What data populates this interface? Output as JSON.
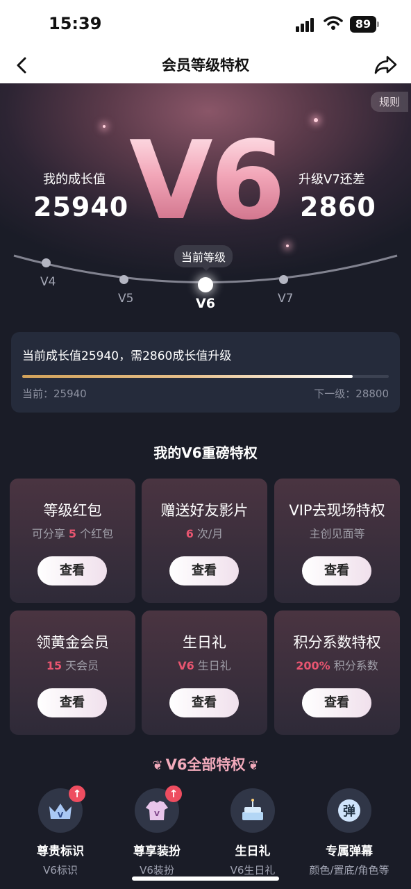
{
  "status_bar": {
    "time": "15:39",
    "battery": "89"
  },
  "nav": {
    "title": "会员等级特权",
    "back_icon": "chevron-left-icon",
    "share_icon": "share-arrow-icon"
  },
  "hero": {
    "rules": "规则",
    "level": "V6",
    "growth_label": "我的成长值",
    "growth_value": "25940",
    "upgrade_label": "升级V7还差",
    "upgrade_value": "2860",
    "current_tip": "当前等级",
    "levels": [
      "V4",
      "V5",
      "V6",
      "V7"
    ],
    "current_level_index": 2
  },
  "progress": {
    "text": "当前成长值25940，需2860成长值升级",
    "current_label": "当前：25940",
    "next_label": "下一级：28800",
    "fraction": 0.9007
  },
  "section_title": "我的V6重磅特权",
  "cards": [
    {
      "title": "等级红包",
      "sub_pre": "可分享 ",
      "sub_hl": "5",
      "sub_post": " 个红包",
      "button": "查看"
    },
    {
      "title": "赠送好友影片",
      "sub_pre": "",
      "sub_hl": "6",
      "sub_post": " 次/月",
      "button": "查看"
    },
    {
      "title": "VIP去现场特权",
      "sub_pre": "主创见面等",
      "sub_hl": "",
      "sub_post": "",
      "button": "查看"
    },
    {
      "title": "领黄金会员",
      "sub_pre": "",
      "sub_hl": "15",
      "sub_post": " 天会员",
      "button": "查看"
    },
    {
      "title": "生日礼",
      "sub_pre": "",
      "sub_hl": "V6",
      "sub_post": " 生日礼",
      "button": "查看"
    },
    {
      "title": "积分系数特权",
      "sub_pre": "",
      "sub_hl": "200%",
      "sub_post": " 积分系数",
      "button": "查看"
    }
  ],
  "all_privileges_title": "V6全部特权",
  "privileges": [
    {
      "icon": "crown-icon",
      "name": "尊贵标识",
      "desc": "V6标识",
      "badge": "↑"
    },
    {
      "icon": "tshirt-icon",
      "name": "尊享装扮",
      "desc": "V6装扮",
      "badge": "↑"
    },
    {
      "icon": "cake-icon",
      "name": "生日礼",
      "desc": "V6生日礼",
      "badge": ""
    },
    {
      "icon": "danmaku-icon",
      "name": "专属弹幕",
      "desc": "颜色/置底/角色等",
      "icon_text": "弹",
      "badge": ""
    }
  ],
  "colors": {
    "highlight": "#e85570",
    "title_pink": "#f2aabb",
    "card_bg": "#252b3b"
  }
}
